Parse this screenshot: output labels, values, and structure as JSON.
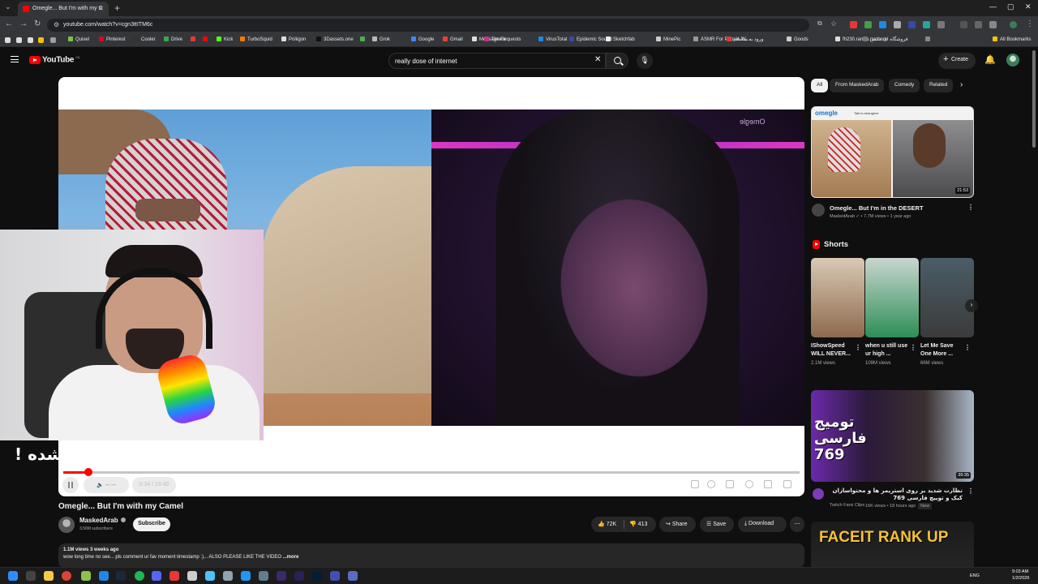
{
  "browser": {
    "tab_title": "Omegle... But I'm with my C",
    "url": "youtube.com/watch?v=cgn3ttITM6c",
    "bookmarks": [
      "Quixel",
      "Pinterest",
      "Cooler",
      "Drive",
      "",
      "",
      "Kick",
      "TurboSquid",
      "Poliigon",
      "3Dassets.one",
      "",
      "Grok",
      "Google",
      "Gmail",
      "Message Requests",
      "Time.ir",
      "VirusTotal",
      "Epidemic Sound",
      "Sketchfab",
      "MinePic",
      "ASMR For People W...",
      "ورود به سامانه",
      "Goods",
      "fh230.rando.ms.com",
      "فروشگاه ای عکس"
    ],
    "all_bookmarks": "All Bookmarks"
  },
  "youtube": {
    "logo_text": "YouTube",
    "logo_region": "CA",
    "search_value": "really dose of internet",
    "create_label": "Create"
  },
  "player": {
    "subtitle_text": "شده !",
    "time": "0:34 / 19:40",
    "progress_fraction": 0.034,
    "watermark": "Omegle"
  },
  "video": {
    "title": "Omegle... But I'm with my Camel",
    "channel": "MaskedArab",
    "subscribers": "3.56M subscribers",
    "subscribe_label": "Subscribe",
    "likes": "72K",
    "dislikes": "413",
    "share_label": "Share",
    "save_label": "Save",
    "download_label": "Download",
    "desc_meta": "1.1M views  3 weeks ago",
    "desc_text": "wow long time no see... pls comment ur fav moment timestamp :)... ALSO PLEASE LIKE THE VIDEO",
    "desc_more": "...more"
  },
  "sidebar": {
    "chips": [
      "All",
      "From MaskedArab",
      "Comedy",
      "Related"
    ],
    "rec1": {
      "omegle_logo": "omegle",
      "tagline": "Talk to strangers!",
      "duration": "21:53",
      "title": "Omegle... But I'm in the DESERT",
      "meta": "MaskedArab ✓ • 7.7M views • 1 year ago"
    },
    "shorts_heading": "Shorts",
    "shorts": [
      {
        "title": "IShowSpeed WILL NEVER...",
        "views": "2.1M views"
      },
      {
        "title": "when u still use ur high ...",
        "views": "109M views"
      },
      {
        "title": "Let Me Save One More ...",
        "views": "66M views"
      }
    ],
    "rec2": {
      "thumb_text": "تومیج فارسی 769",
      "duration": "39:35",
      "title": "نظارت شدید بر روی استریمر ها و محتواسازان کیک و توییچ فارسی 769",
      "channel": "Twitch Farsi Clips",
      "meta": "16K views • 18 hours ago",
      "badge": "New"
    },
    "rec3": {
      "thumb_text": "FACEIT RANK UP"
    }
  },
  "taskbar": {
    "lang": "ENG",
    "time": "9:03 AM",
    "date": "1/2/2026"
  },
  "colors": {
    "accent": "#ff0000",
    "bg": "#0f0f0f",
    "chip": "#272727"
  }
}
